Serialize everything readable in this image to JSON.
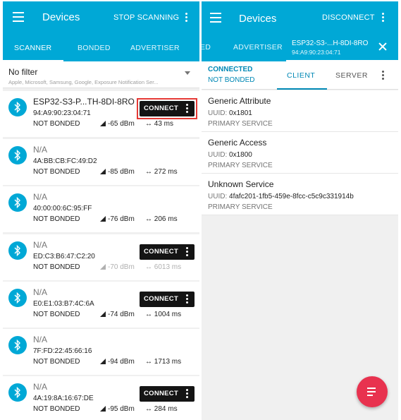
{
  "left": {
    "title": "Devices",
    "action": "STOP SCANNING",
    "tabs": [
      "SCANNER",
      "BONDED",
      "ADVERTISER"
    ],
    "filter": {
      "label": "No filter",
      "sub": "Apple, Microsoft, Samsung, Google, Exposure Notification Ser..."
    },
    "devices": [
      {
        "name": "ESP32-S3-P...TH-8DI-8RO",
        "address": "94:A9:90:23:04:71",
        "bond": "NOT BONDED",
        "rssi": "-65 dBm",
        "interval": "43 ms",
        "connect": "CONNECT"
      },
      {
        "name": "N/A",
        "address": "4A:BB:CB:FC:49:D2",
        "bond": "NOT BONDED",
        "rssi": "-85 dBm",
        "interval": "272 ms"
      },
      {
        "name": "N/A",
        "address": "40:00:00:6C:95:FF",
        "bond": "NOT BONDED",
        "rssi": "-76 dBm",
        "interval": "206 ms"
      },
      {
        "name": "N/A",
        "address": "ED:C3:B6:47:C2:20",
        "bond": "NOT BONDED",
        "rssi": "-70 dBm",
        "interval": "6013 ms",
        "connect": "CONNECT"
      },
      {
        "name": "N/A",
        "address": "E0:E1:03:B7:4C:6A",
        "bond": "NOT BONDED",
        "rssi": "-74 dBm",
        "interval": "1004 ms",
        "connect": "CONNECT"
      },
      {
        "name": "N/A",
        "address": "7F:FD:22:45:66:16",
        "bond": "NOT BONDED",
        "rssi": "-94 dBm",
        "interval": "1713 ms"
      },
      {
        "name": "N/A",
        "address": "4A:19:8A:16:67:DE",
        "bond": "NOT BONDED",
        "rssi": "-95 dBm",
        "interval": "284 ms",
        "connect": "CONNECT"
      }
    ]
  },
  "right": {
    "title": "Devices",
    "action": "DISCONNECT",
    "tabs": [
      "ED",
      "ADVERTISER"
    ],
    "device_tab": {
      "name": "ESP32-S3-...H-8DI-8RO",
      "address": "94:A9:90:23:04:71"
    },
    "status": {
      "connected": "CONNECTED",
      "bond": "NOT BONDED"
    },
    "subtabs": [
      "CLIENT",
      "SERVER"
    ],
    "uuid_label": "UUID:",
    "services": [
      {
        "name": "Generic Attribute",
        "uuid": "0x1801",
        "type": "PRIMARY SERVICE"
      },
      {
        "name": "Generic Access",
        "uuid": "0x1800",
        "type": "PRIMARY SERVICE"
      },
      {
        "name": "Unknown Service",
        "uuid": "4fafc201-1fb5-459e-8fcc-c5c9c331914b",
        "type": "PRIMARY SERVICE"
      }
    ]
  },
  "colors": {
    "accent": "#00a8d6",
    "fab": "#e8324f",
    "highlight": "#e53935"
  },
  "icons": [
    "menu-icon",
    "more-vert-icon",
    "bluetooth-icon",
    "signal-icon",
    "interval-icon",
    "close-icon",
    "fab-list-icon"
  ]
}
